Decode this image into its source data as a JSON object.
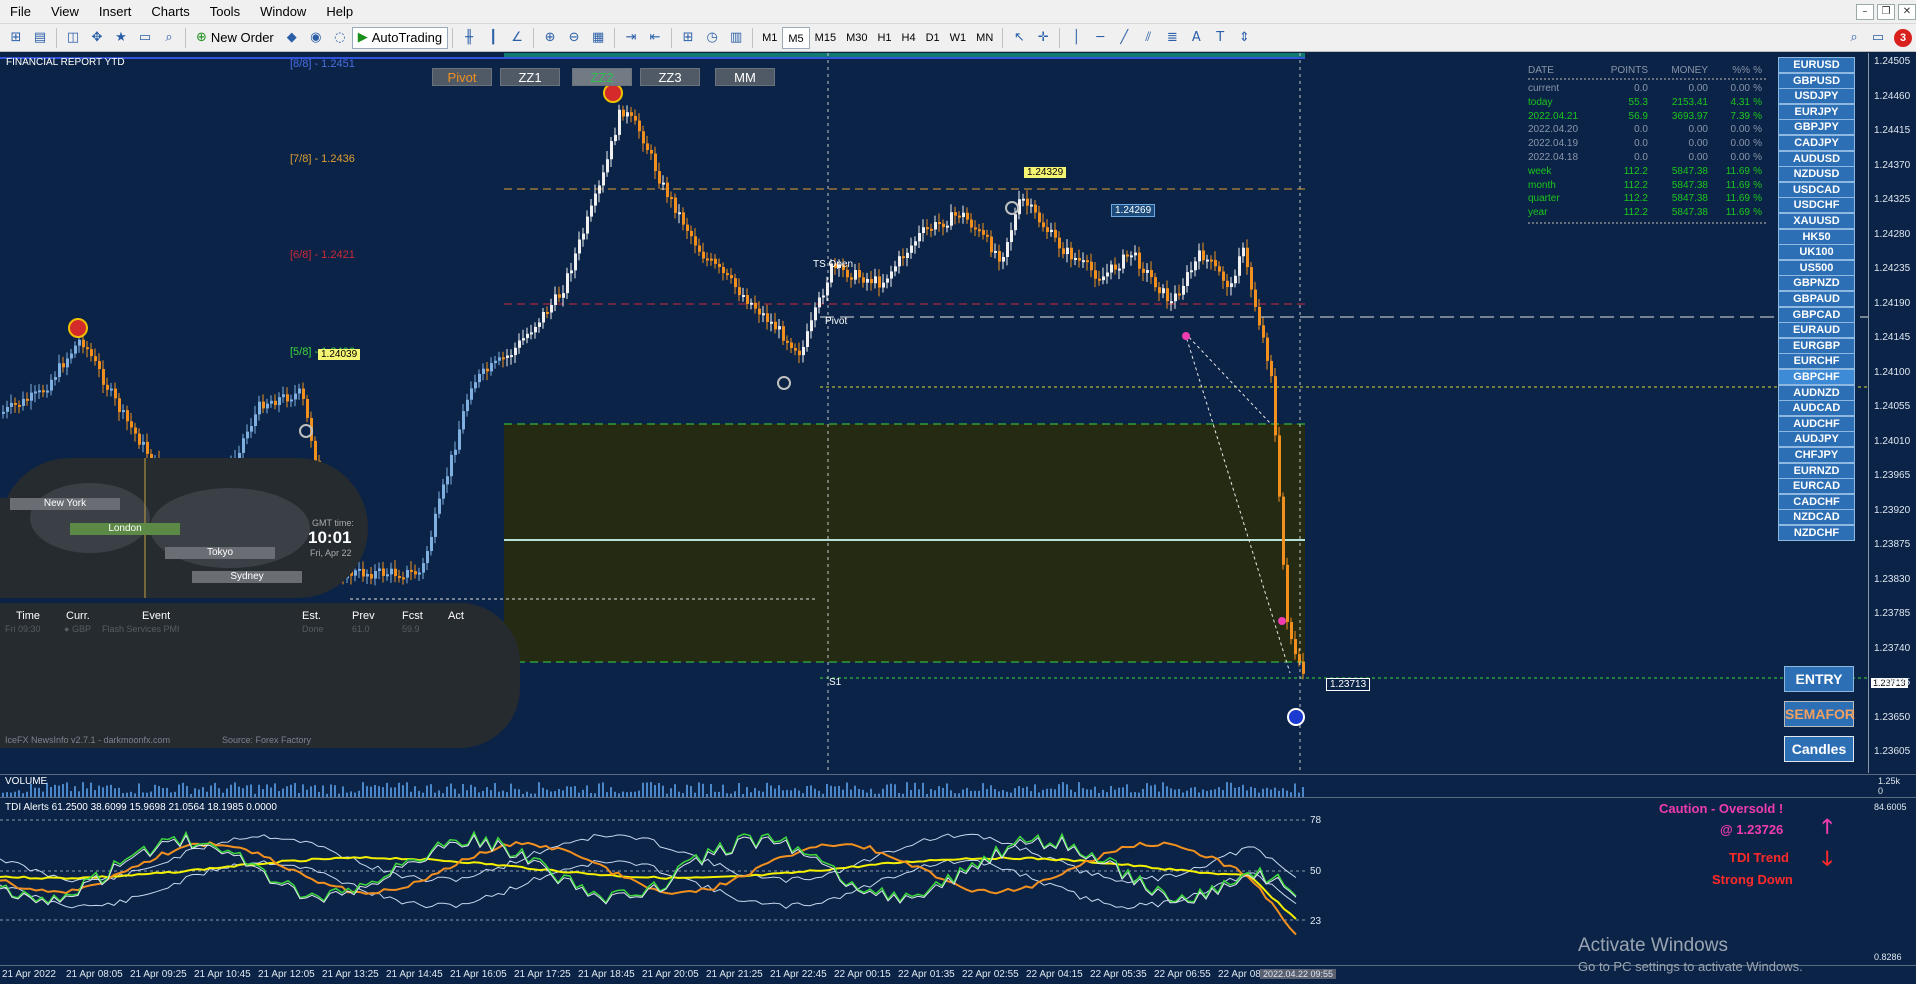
{
  "menu": [
    "File",
    "View",
    "Insert",
    "Charts",
    "Tools",
    "Window",
    "Help"
  ],
  "notification_count": "3",
  "toolbar": {
    "new_order": "New Order",
    "autotrading": "AutoTrading",
    "timeframes": [
      "M1",
      "M5",
      "M15",
      "M30",
      "H1",
      "H4",
      "D1",
      "W1",
      "MN"
    ],
    "active_tf": "M5"
  },
  "chart": {
    "title": "FINANCIAL REPORT YTD",
    "top_buttons": [
      "Pivot",
      "ZZ1",
      "ZZ2",
      "ZZ3",
      "MM"
    ],
    "levels": {
      "l88": "[8/8] - 1.2451",
      "l78": "[7/8] - 1.2436",
      "l68": "[6/8] - 1.2421",
      "l58": "[5/8] - 1.2406"
    },
    "price_tags": {
      "high1": "1.24329",
      "high2": "1.24269",
      "mid": "1.24039",
      "current": "1.23713",
      "axis_current": "1.23713"
    },
    "labels": {
      "ts_open": "TS Open",
      "pivot": "Pivot",
      "s1": "S1"
    },
    "price_axis": [
      "1.24505",
      "1.24460",
      "1.24415",
      "1.24370",
      "1.24325",
      "1.24280",
      "1.24235",
      "1.24190",
      "1.24145",
      "1.24100",
      "1.24055",
      "1.24010",
      "1.23965",
      "1.23920",
      "1.23875",
      "1.23830",
      "1.23785",
      "1.23740",
      "1.23695",
      "1.23650",
      "1.23605"
    ]
  },
  "report": {
    "headers": [
      "DATE",
      "POINTS",
      "MONEY",
      "%%",
      "%"
    ],
    "rows": [
      {
        "d": "current",
        "p": "0.0",
        "m": "0.00",
        "pc": "0.00",
        "s": "%",
        "g": false
      },
      {
        "d": "today",
        "p": "55.3",
        "m": "2153.41",
        "pc": "4.31",
        "s": "%",
        "g": true
      },
      {
        "d": " 2022.04.21",
        "p": "56.9",
        "m": "3693.97",
        "pc": "7.39",
        "s": "%",
        "g": true
      },
      {
        "d": " 2022.04.20",
        "p": "0.0",
        "m": "0.00",
        "pc": "0.00",
        "s": "%",
        "g": false
      },
      {
        "d": " 2022.04.19",
        "p": "0.0",
        "m": "0.00",
        "pc": "0.00",
        "s": "%",
        "g": false
      },
      {
        "d": " 2022.04.18",
        "p": "0.0",
        "m": "0.00",
        "pc": "0.00",
        "s": "%",
        "g": false
      },
      {
        "d": "week",
        "p": "112.2",
        "m": "5847.38",
        "pc": "11.69",
        "s": "%",
        "g": true
      },
      {
        "d": " month",
        "p": "112.2",
        "m": "5847.38",
        "pc": "11.69",
        "s": "%",
        "g": true
      },
      {
        "d": " quarter",
        "p": "112.2",
        "m": "5847.38",
        "pc": "11.69",
        "s": "%",
        "g": true
      },
      {
        "d": "year",
        "p": "112.2",
        "m": "5847.38",
        "pc": "11.69",
        "s": "%",
        "g": true
      }
    ]
  },
  "symbols": [
    "EURUSD",
    "GBPUSD",
    "USDJPY",
    "EURJPY",
    "GBPJPY",
    "CADJPY",
    "AUDUSD",
    "NZDUSD",
    "USDCAD",
    "USDCHF",
    "XAUUSD",
    "HK50",
    "UK100",
    "US500",
    "GBPNZD",
    "GBPAUD",
    "GBPCAD",
    "EURAUD",
    "EURGBP",
    "EURCHF",
    "GBPCHF",
    "AUDNZD",
    "AUDCAD",
    "AUDCHF",
    "AUDJPY",
    "CHFJPY",
    "EURNZD",
    "EURCAD",
    "CADCHF",
    "NZDCAD",
    "NZDCHF"
  ],
  "action_buttons": {
    "entry": "ENTRY",
    "semafor": "SEMAFOR",
    "candles": "Candles"
  },
  "news": {
    "sessions": [
      "New York",
      "London",
      "Tokyo",
      "Sydney"
    ],
    "gmt_label": "GMT time:",
    "gmt_time": "10:01",
    "gmt_date": "Fri, Apr 22",
    "headers": [
      "Time",
      "Curr.",
      "Event",
      "Est.",
      "Prev",
      "Fcst",
      "Act"
    ],
    "row": {
      "time": "Fri  09:30",
      "curr": "GBP",
      "event": "Flash Services PMI",
      "est": "Done",
      "prev": "61.0",
      "fcst": "59.9",
      "act": ""
    },
    "footer": "IceFX NewsInfo v2.7.1  -  darkmoonfx.com",
    "source": "Source: Forex Factory"
  },
  "volume": {
    "label": "VOLUME",
    "axis_top": "1.25k",
    "axis_bottom": "0"
  },
  "tdi": {
    "label": "TDI Alerts  61.2500 38.6099 15.9698 21.0564 18.1985 0.0000",
    "levels": [
      "78",
      "50",
      "23"
    ],
    "axis_top": "84.6005",
    "axis_bottom": "0.8286",
    "alert1": "Caution - Oversold !",
    "alert2": "@ 1.23726",
    "alert3": "TDI Trend",
    "alert4": "Strong Down"
  },
  "time_axis": [
    "21 Apr 2022",
    "21 Apr 08:05",
    "21 Apr 09:25",
    "21 Apr 10:45",
    "21 Apr 12:05",
    "21 Apr 13:25",
    "21 Apr 14:45",
    "21 Apr 16:05",
    "21 Apr 17:25",
    "21 Apr 18:45",
    "21 Apr 20:05",
    "21 Apr 21:25",
    "21 Apr 22:45",
    "22 Apr 00:15",
    "22 Apr 01:35",
    "22 Apr 02:55",
    "22 Apr 04:15",
    "22 Apr 05:35",
    "22 Apr 06:55",
    "22 Apr 08:15"
  ],
  "time_cursor": "2022.04.22 09:55",
  "watermark": {
    "line1": "Activate Windows",
    "line2": "Go to PC settings to activate Windows."
  },
  "colors": {
    "bg": "#0a2347",
    "bull": "#f0f0f0",
    "bear": "#f2901f",
    "range": "#252a12"
  }
}
